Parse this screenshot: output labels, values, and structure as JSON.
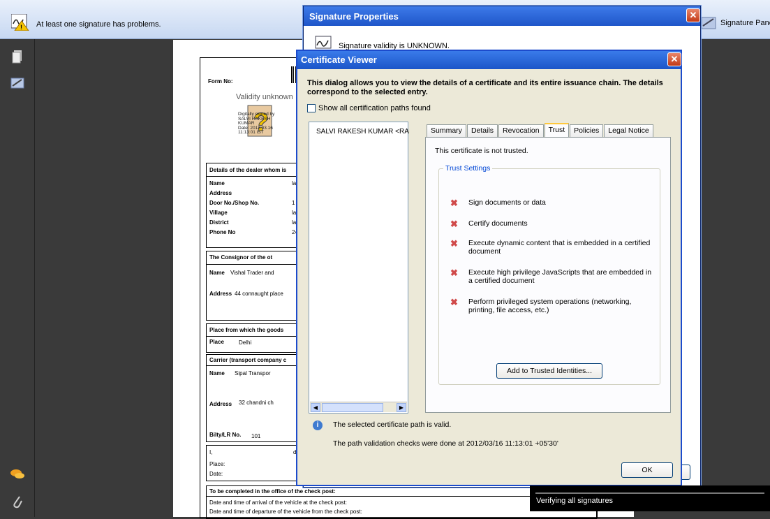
{
  "sigbar": {
    "message": "At least one signature has problems.",
    "panel_label": "Signature Pane"
  },
  "document": {
    "form_no_label": "Form No:",
    "stamp": {
      "title": "Validity unknown",
      "lines": [
        "Digitally signed by",
        "SALVI RAKESH",
        "KUMAR",
        "Date: 2012.03.16",
        "11:13:01 IST"
      ]
    },
    "dealer_heading": "Details of the dealer whom is",
    "dealer_rows": [
      {
        "label": "Name",
        "value": "lan"
      },
      {
        "label": "Address",
        "value": ""
      },
      {
        "label": "Door No./Shop No.",
        "value": "1"
      },
      {
        "label": "Village",
        "value": "lat"
      },
      {
        "label": "District",
        "value": "lat"
      },
      {
        "label": "Phone No",
        "value": "24"
      }
    ],
    "consignor_heading": "The Consignor      of the ot",
    "consignor_name_label": "Name",
    "consignor_name_value": "Vishal Trader and",
    "consignor_address_label": "Address",
    "consignor_address_value": "44 connaught place",
    "place_heading": "Place from which the goods",
    "place_label": "Place",
    "place_value": "Delhi",
    "carrier_heading": "Carrier (transport company c",
    "carrier_name_label": "Name",
    "carrier_name_value": "Sipal Transpor",
    "carrier_address_label": "Address",
    "carrier_address_value": "32 chandni ch",
    "bilty_label": "Bilty/LR No.",
    "bilty_value": "101",
    "decl_i": "I,",
    "decl_suffix": "dec",
    "decl_place": "Place:",
    "decl_date": "Date:",
    "office_heading": "To be completed in the office of the check post:",
    "office_arrival": "Date and time of arrival of the vehicle at the  check post:",
    "office_departure": "Date and time of departure of the vehicle from the check post:"
  },
  "sig_props": {
    "title": "Signature Properties",
    "validity": "Signature validity is UNKNOWN."
  },
  "cert_viewer": {
    "title": "Certificate Viewer",
    "description": "This dialog allows you to view the details of a certificate and its entire issuance chain. The details correspond to the selected entry.",
    "show_all_paths": "Show all certification paths found",
    "show_all_checked": false,
    "tree_item": "SALVI RAKESH KUMAR <RA",
    "tabs": [
      "Summary",
      "Details",
      "Revocation",
      "Trust",
      "Policies",
      "Legal Notice"
    ],
    "active_tab": "Trust",
    "not_trusted": "This certificate is not trusted.",
    "trust_settings_label": "Trust Settings",
    "trust_items": [
      "Sign documents or data",
      "Certify documents",
      "Execute dynamic content that is embedded in a certified document",
      "Execute high privilege JavaScripts that are embedded in a certified document",
      "Perform privileged system operations (networking, printing, file access, etc.)"
    ],
    "add_button": "Add to Trusted Identities...",
    "status_valid": "The selected certificate path is valid.",
    "status_checks": "The path validation checks were done at 2012/03/16 11:13:01 +05'30'",
    "ok_button": "OK"
  },
  "toast": {
    "text": "Verifying all signatures"
  }
}
